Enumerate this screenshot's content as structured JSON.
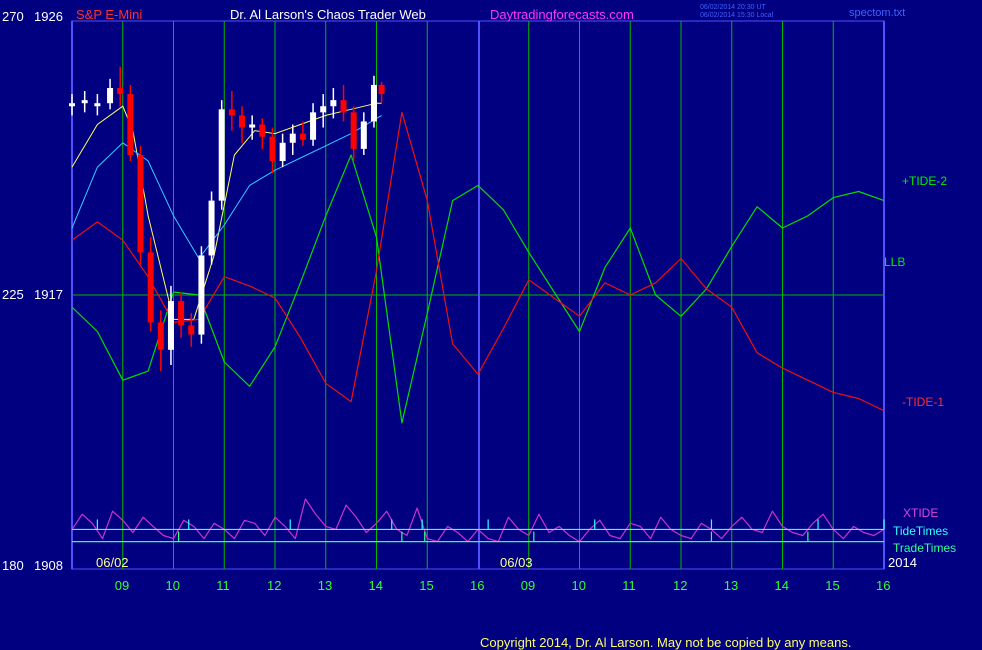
{
  "header": {
    "symbol": "S&P E-Mini",
    "title": "Dr. Al Larson's Chaos Trader Web",
    "site": "Daytradingforecasts.com",
    "timestamp_ut": "06/02/2014 20:30 UT",
    "timestamp_local": "06/02/2014 15:30 Local",
    "file": "spectom.txt"
  },
  "axis": {
    "left_top": [
      "270",
      "1926"
    ],
    "left_mid": [
      "225",
      "1917"
    ],
    "left_bot": [
      "180",
      "1908"
    ],
    "hour_labels": [
      "09",
      "10",
      "11",
      "12",
      "13",
      "14",
      "15",
      "16",
      "09",
      "10",
      "11",
      "12",
      "13",
      "14",
      "15",
      "16"
    ],
    "date_labels": [
      "06/02",
      "06/03"
    ],
    "year": "2014"
  },
  "legend": {
    "tide2": "+TIDE-2",
    "llb": "LLB",
    "tide1": "-TIDE-1",
    "xtide": "XTIDE",
    "tidetimes": "TideTimes",
    "tradetimes": "TradeTimes"
  },
  "copyright": "Copyright 2014, Dr. Al Larson. May not be copied by any means.",
  "colors": {
    "background": "#000080",
    "grid": "#00b800",
    "border": "#5050ff",
    "price_up": "#ffffff",
    "price_down": "#ff0000",
    "tide2": "#00dd00",
    "tide1": "#ee1010",
    "xtide": "#cc33cc",
    "ma_fast": "#ffff66",
    "ma_slow": "#33ccff",
    "tidetimes": "#33ffff",
    "tradetimes": "#33ff99"
  },
  "chart_data": {
    "type": "line",
    "ylim": [
      1908,
      1926
    ],
    "x_range_hours": [
      0,
      16
    ],
    "price_bars": [
      [
        0.0,
        1923.2,
        1923.6,
        1922.9,
        1923.3
      ],
      [
        0.25,
        1923.3,
        1923.7,
        1923.0,
        1923.4
      ],
      [
        0.5,
        1923.2,
        1923.6,
        1922.9,
        1923.3
      ],
      [
        0.75,
        1923.3,
        1924.1,
        1923.1,
        1923.8
      ],
      [
        0.95,
        1923.8,
        1924.5,
        1923.2,
        1923.6
      ],
      [
        1.15,
        1923.6,
        1923.9,
        1921.4,
        1921.6
      ],
      [
        1.35,
        1921.6,
        1921.9,
        1918.0,
        1918.4
      ],
      [
        1.55,
        1918.4,
        1918.9,
        1915.8,
        1916.1
      ],
      [
        1.75,
        1916.1,
        1916.5,
        1914.5,
        1915.2
      ],
      [
        1.95,
        1915.2,
        1917.3,
        1914.7,
        1916.8
      ],
      [
        2.15,
        1916.8,
        1917.1,
        1915.6,
        1916.0
      ],
      [
        2.35,
        1916.0,
        1916.4,
        1915.3,
        1915.7
      ],
      [
        2.55,
        1915.7,
        1918.6,
        1915.4,
        1918.3
      ],
      [
        2.75,
        1918.3,
        1920.4,
        1918.0,
        1920.1
      ],
      [
        2.95,
        1920.1,
        1923.4,
        1919.8,
        1923.1
      ],
      [
        3.15,
        1923.1,
        1923.7,
        1922.4,
        1922.9
      ],
      [
        3.35,
        1922.9,
        1923.2,
        1922.0,
        1922.5
      ],
      [
        3.55,
        1922.5,
        1922.9,
        1922.1,
        1922.6
      ],
      [
        3.75,
        1922.6,
        1922.8,
        1921.8,
        1922.2
      ],
      [
        3.95,
        1922.2,
        1922.5,
        1921.0,
        1921.4
      ],
      [
        4.15,
        1921.4,
        1922.3,
        1921.2,
        1922.0
      ],
      [
        4.35,
        1922.0,
        1922.6,
        1921.6,
        1922.3
      ],
      [
        4.55,
        1922.3,
        1922.7,
        1921.9,
        1922.1
      ],
      [
        4.75,
        1922.1,
        1923.3,
        1921.9,
        1923.0
      ],
      [
        4.95,
        1923.0,
        1923.6,
        1922.5,
        1923.2
      ],
      [
        5.15,
        1923.2,
        1923.8,
        1922.8,
        1923.4
      ],
      [
        5.35,
        1923.4,
        1923.9,
        1922.7,
        1923.0
      ],
      [
        5.55,
        1923.0,
        1923.2,
        1921.4,
        1921.8
      ],
      [
        5.75,
        1921.8,
        1923.0,
        1921.6,
        1922.7
      ],
      [
        5.95,
        1922.7,
        1924.2,
        1922.5,
        1923.9
      ],
      [
        6.1,
        1923.9,
        1924.0,
        1923.3,
        1923.6
      ]
    ],
    "series": [
      {
        "name": "+TIDE-2",
        "x": [
          0,
          0.5,
          1,
          1.5,
          2,
          2.5,
          3,
          3.5,
          4,
          4.5,
          5,
          5.5,
          6,
          6.5,
          7,
          7.5,
          8,
          8.5,
          9,
          9.5,
          10,
          10.5,
          11,
          11.5,
          12,
          12.5,
          13,
          13.5,
          14,
          14.5,
          15,
          15.5,
          16
        ],
        "y": [
          1916.6,
          1915.8,
          1914.2,
          1914.5,
          1917.1,
          1917.0,
          1914.8,
          1914.0,
          1915.3,
          1917.4,
          1919.6,
          1921.6,
          1918.9,
          1912.8,
          1916.4,
          1920.1,
          1920.6,
          1919.8,
          1918.4,
          1917.1,
          1915.8,
          1917.9,
          1919.2,
          1917.0,
          1916.3,
          1917.2,
          1918.6,
          1919.9,
          1919.2,
          1919.6,
          1920.2,
          1920.4,
          1920.1
        ]
      },
      {
        "name": "-TIDE-1",
        "x": [
          0,
          0.5,
          1,
          1.5,
          2,
          2.5,
          3,
          3.5,
          4,
          4.5,
          5,
          5.5,
          6,
          6.5,
          7,
          7.5,
          8,
          8.5,
          9,
          9.5,
          10,
          10.5,
          11,
          11.5,
          12,
          12.5,
          13,
          13.5,
          14,
          14.5,
          15,
          15.5,
          16
        ],
        "y": [
          1918.8,
          1919.4,
          1918.8,
          1917.6,
          1916.1,
          1916.2,
          1917.6,
          1917.3,
          1916.9,
          1915.6,
          1914.1,
          1913.5,
          1917.8,
          1923.0,
          1920.1,
          1915.4,
          1914.4,
          1915.9,
          1917.5,
          1916.9,
          1916.3,
          1917.4,
          1917.0,
          1917.4,
          1918.2,
          1917.2,
          1916.6,
          1915.1,
          1914.6,
          1914.2,
          1913.8,
          1913.6,
          1913.2
        ]
      },
      {
        "name": "XTIDE",
        "x": [
          0,
          0.2,
          0.4,
          0.6,
          0.8,
          1.0,
          1.2,
          1.4,
          1.6,
          1.8,
          2.0,
          2.2,
          2.4,
          2.6,
          2.8,
          3.0,
          3.2,
          3.4,
          3.6,
          3.8,
          4.0,
          4.2,
          4.4,
          4.6,
          4.8,
          5.0,
          5.2,
          5.4,
          5.6,
          5.8,
          6.0,
          6.2,
          6.4,
          6.6,
          6.8,
          7.0,
          7.2,
          7.4,
          7.6,
          7.8,
          8.0,
          8.2,
          8.4,
          8.6,
          8.8,
          9.0,
          9.2,
          9.4,
          9.6,
          9.8,
          10.0,
          10.2,
          10.4,
          10.6,
          10.8,
          11.0,
          11.2,
          11.4,
          11.6,
          11.8,
          12.0,
          12.2,
          12.4,
          12.6,
          12.8,
          13.0,
          13.2,
          13.4,
          13.6,
          13.8,
          14.0,
          14.2,
          14.4,
          14.6,
          14.8,
          15.0,
          15.2,
          15.4,
          15.6,
          15.8,
          16.0
        ],
        "y": [
          1909.3,
          1909.8,
          1909.5,
          1909.0,
          1909.9,
          1909.6,
          1909.2,
          1909.7,
          1909.4,
          1909.1,
          1909.0,
          1909.6,
          1909.4,
          1909.0,
          1909.5,
          1909.3,
          1909.0,
          1909.6,
          1909.5,
          1909.1,
          1909.7,
          1909.4,
          1909.0,
          1910.3,
          1909.8,
          1909.4,
          1909.3,
          1910.1,
          1909.7,
          1909.2,
          1909.5,
          1909.9,
          1909.3,
          1909.1,
          1910.0,
          1909.0,
          1908.9,
          1909.4,
          1909.2,
          1908.9,
          1909.3,
          1909.0,
          1908.9,
          1909.7,
          1909.3,
          1909.1,
          1909.8,
          1909.2,
          1909.4,
          1909.1,
          1908.9,
          1909.3,
          1909.6,
          1909.1,
          1909.0,
          1909.5,
          1909.4,
          1909.0,
          1909.7,
          1909.3,
          1909.1,
          1909.0,
          1909.5,
          1909.3,
          1909.0,
          1909.4,
          1909.7,
          1909.3,
          1909.2,
          1909.9,
          1909.4,
          1909.2,
          1909.1,
          1909.5,
          1909.8,
          1909.3,
          1909.0,
          1909.4,
          1909.2,
          1909.1,
          1909.3
        ]
      },
      {
        "name": "TideTimes",
        "level": 1909.3,
        "x": [
          0.5,
          2.3,
          4.3,
          6.3,
          6.9,
          8.2,
          10.3,
          12.6,
          14.7,
          16.0
        ]
      },
      {
        "name": "TradeTimes",
        "level": 1908.9,
        "x": [
          2.1,
          6.5,
          6.95,
          9.1,
          12.6,
          14.5
        ]
      }
    ],
    "moving_averages": [
      {
        "x": [
          0,
          0.5,
          1,
          1.2,
          1.5,
          2,
          2.4,
          2.8,
          3.2,
          3.6,
          4,
          4.5,
          5,
          5.5,
          6,
          6.1
        ],
        "y": [
          1921.2,
          1922.6,
          1923.2,
          1922.4,
          1919.6,
          1916.2,
          1916.2,
          1918.3,
          1921.6,
          1922.4,
          1922.3,
          1922.6,
          1922.9,
          1923.1,
          1923.3,
          1923.3
        ]
      },
      {
        "x": [
          0,
          0.5,
          1,
          1.5,
          2,
          2.5,
          3,
          3.5,
          4,
          4.5,
          5,
          5.5,
          6,
          6.1
        ],
        "y": [
          1919.2,
          1921.2,
          1922.0,
          1921.4,
          1919.6,
          1918.2,
          1919.3,
          1920.6,
          1921.1,
          1921.5,
          1921.9,
          1922.3,
          1922.8,
          1922.9
        ]
      }
    ]
  }
}
